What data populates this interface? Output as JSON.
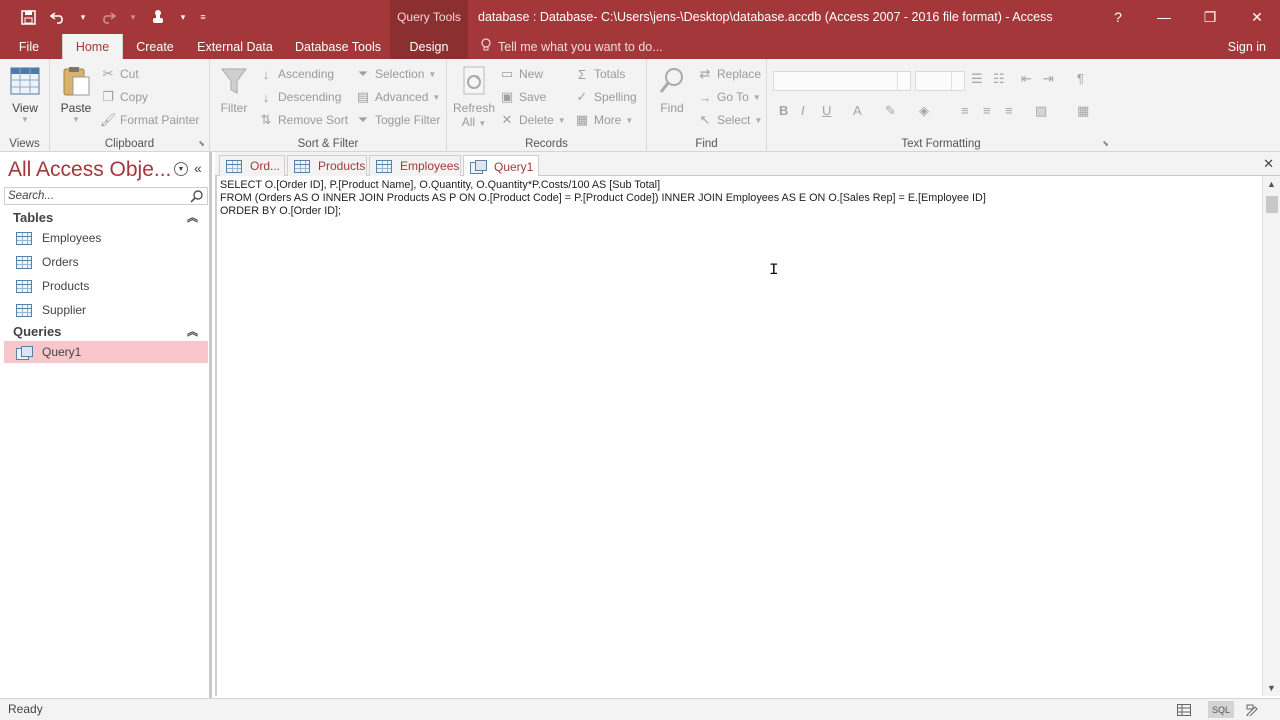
{
  "titlebar": {
    "contextual_label": "Query Tools",
    "title": "database : Database- C:\\Users\\jens-\\Desktop\\database.accdb (Access 2007 - 2016 file format) - Access",
    "help": "?",
    "minimize": "—",
    "restore": "❐",
    "close": "✕"
  },
  "tabs": {
    "file": "File",
    "home": "Home",
    "create": "Create",
    "external_data": "External Data",
    "database_tools": "Database Tools",
    "design": "Design",
    "tell_me": "Tell me what you want to do...",
    "sign_in": "Sign in"
  },
  "ribbon": {
    "views": {
      "view": "View",
      "label": "Views"
    },
    "clipboard": {
      "paste": "Paste",
      "cut": "Cut",
      "copy": "Copy",
      "format_painter": "Format Painter",
      "label": "Clipboard"
    },
    "sort_filter": {
      "filter": "Filter",
      "ascending": "Ascending",
      "descending": "Descending",
      "remove_sort": "Remove Sort",
      "selection": "Selection",
      "advanced": "Advanced",
      "toggle_filter": "Toggle Filter",
      "label": "Sort & Filter"
    },
    "records": {
      "refresh": "Refresh",
      "refresh_all": "All",
      "new": "New",
      "save": "Save",
      "delete": "Delete",
      "totals": "Totals",
      "spelling": "Spelling",
      "more": "More",
      "label": "Records"
    },
    "find": {
      "find": "Find",
      "replace": "Replace",
      "goto": "Go To",
      "select": "Select",
      "label": "Find"
    },
    "text_formatting": {
      "label": "Text Formatting"
    }
  },
  "nav": {
    "title": "All Access Obje...",
    "search_placeholder": "Search...",
    "tables_header": "Tables",
    "tables": [
      "Employees",
      "Orders",
      "Products",
      "Supplier"
    ],
    "queries_header": "Queries",
    "queries": [
      "Query1"
    ]
  },
  "doc_tabs": [
    "Ord...",
    "Products",
    "Employees",
    "Query1"
  ],
  "sql": {
    "line1": "SELECT O.[Order ID], P.[Product Name], O.Quantity, O.Quantity*P.Costs/100 AS [Sub Total]",
    "line2": "FROM (Orders AS O INNER JOIN Products AS P ON O.[Product Code] = P.[Product Code]) INNER JOIN Employees AS E ON O.[Sales Rep] = E.[Employee ID]",
    "line3": "ORDER BY O.[Order ID];"
  },
  "status": {
    "text": "Ready",
    "sql_view": "SQL"
  },
  "colors": {
    "accent": "#a4373a",
    "contextual": "#8c2f31",
    "selection": "#f8c7cb"
  }
}
